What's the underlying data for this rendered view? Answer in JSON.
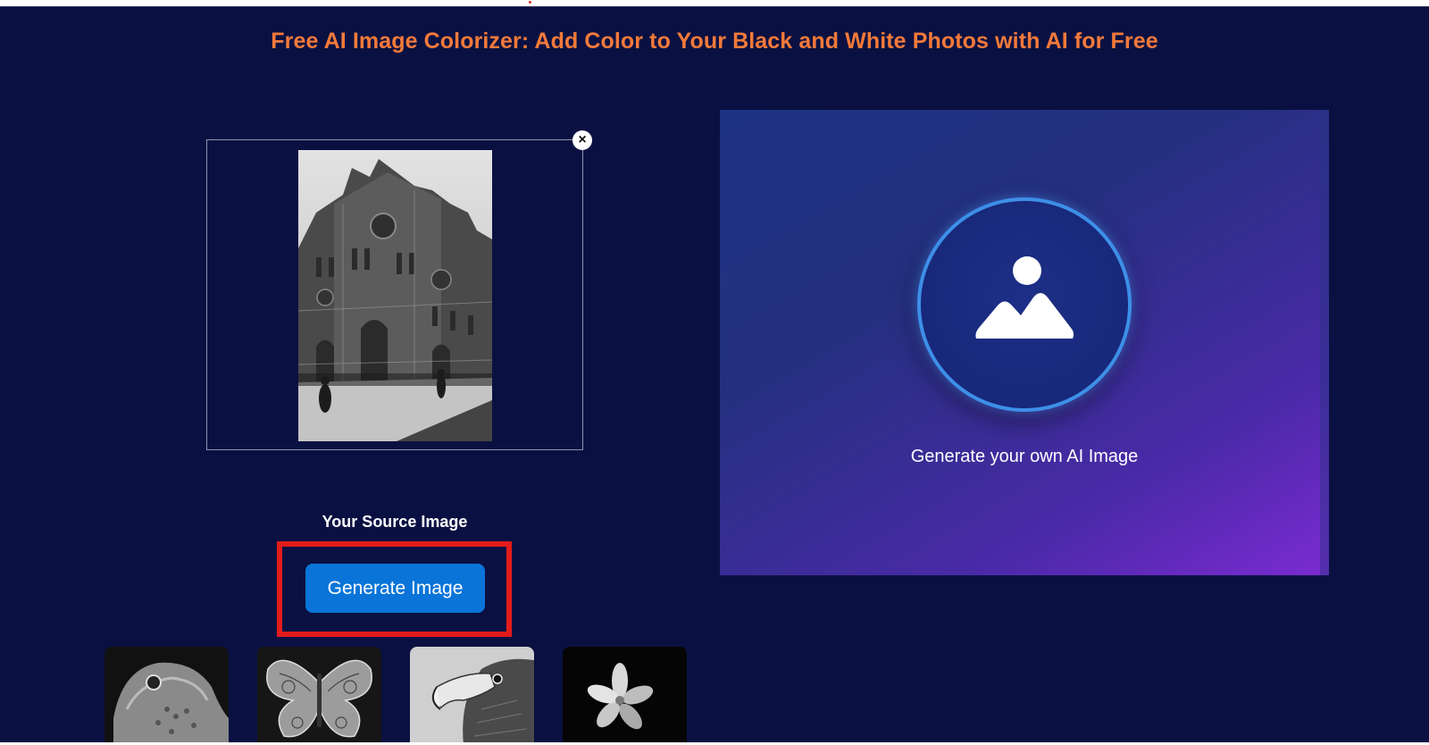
{
  "header": {
    "title": "Free AI Image Colorizer: Add Color to Your Black and White Photos with AI for Free"
  },
  "source": {
    "remove_icon": "×",
    "photo_icon": "cathedral-photo",
    "label": "Your Source Image"
  },
  "actions": {
    "generate_label": "Generate Image"
  },
  "output": {
    "icon": "image-placeholder-icon",
    "caption": "Generate your own AI Image"
  },
  "samples": [
    {
      "name": "lizard"
    },
    {
      "name": "butterfly"
    },
    {
      "name": "eagle"
    },
    {
      "name": "flower"
    }
  ],
  "colors": {
    "background": "#0a1142",
    "title": "#f47a3a",
    "button": "#0a74d8",
    "highlight": "#e31b1b",
    "output_gradient_start": "#1e3283",
    "output_gradient_end": "#7b2bd1"
  }
}
